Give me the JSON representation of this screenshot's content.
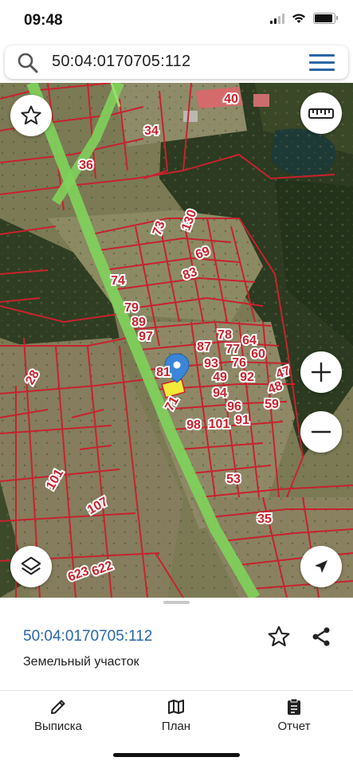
{
  "status_bar": {
    "time": "09:48"
  },
  "search": {
    "query": "50:04:0170705:112"
  },
  "map": {
    "parcel_labels": [
      "40",
      "34",
      "36",
      "130",
      "73",
      "69",
      "83",
      "74",
      "79",
      "89",
      "97",
      "87",
      "78",
      "77",
      "64",
      "60",
      "93",
      "76",
      "81",
      "49",
      "92",
      "47",
      "94",
      "48",
      "71",
      "96",
      "59",
      "28",
      "91",
      "101",
      "98",
      "53",
      "101",
      "107",
      "35",
      "623",
      "622"
    ],
    "colors": {
      "parcel_border": "#c8222e",
      "road": "#7fd15b",
      "marker": "#3b86d8",
      "selected_parcel": "#f3ea3a"
    }
  },
  "selected_parcel": {
    "cadastral_number": "50:04:0170705:112",
    "type": "Земельный участок"
  },
  "tabs": [
    {
      "label": "Выписка",
      "icon": "pencil-icon"
    },
    {
      "label": "План",
      "icon": "map-icon"
    },
    {
      "label": "Отчет",
      "icon": "clipboard-icon"
    }
  ]
}
